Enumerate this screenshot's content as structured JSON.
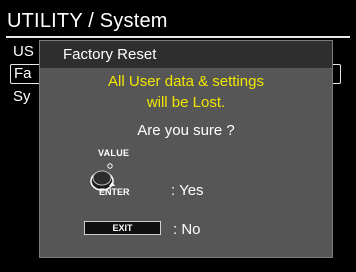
{
  "screen": {
    "title": "UTILITY / System",
    "background_items": [
      "US",
      "Fa",
      "Sy"
    ]
  },
  "dialog": {
    "title": "Factory Reset",
    "warning_line1": "All User data & settings",
    "warning_line2": "will be Lost.",
    "question": "Are you sure ?",
    "value_label": "VALUE",
    "enter_label": "ENTER",
    "yes_label": ": Yes",
    "exit_label": "EXIT",
    "no_label": ": No"
  },
  "colors": {
    "warning": "#f2e600",
    "dialog_bg": "#565656",
    "header_bg": "#2e2e2e"
  },
  "icons": {
    "knob": "value-knob-icon"
  }
}
